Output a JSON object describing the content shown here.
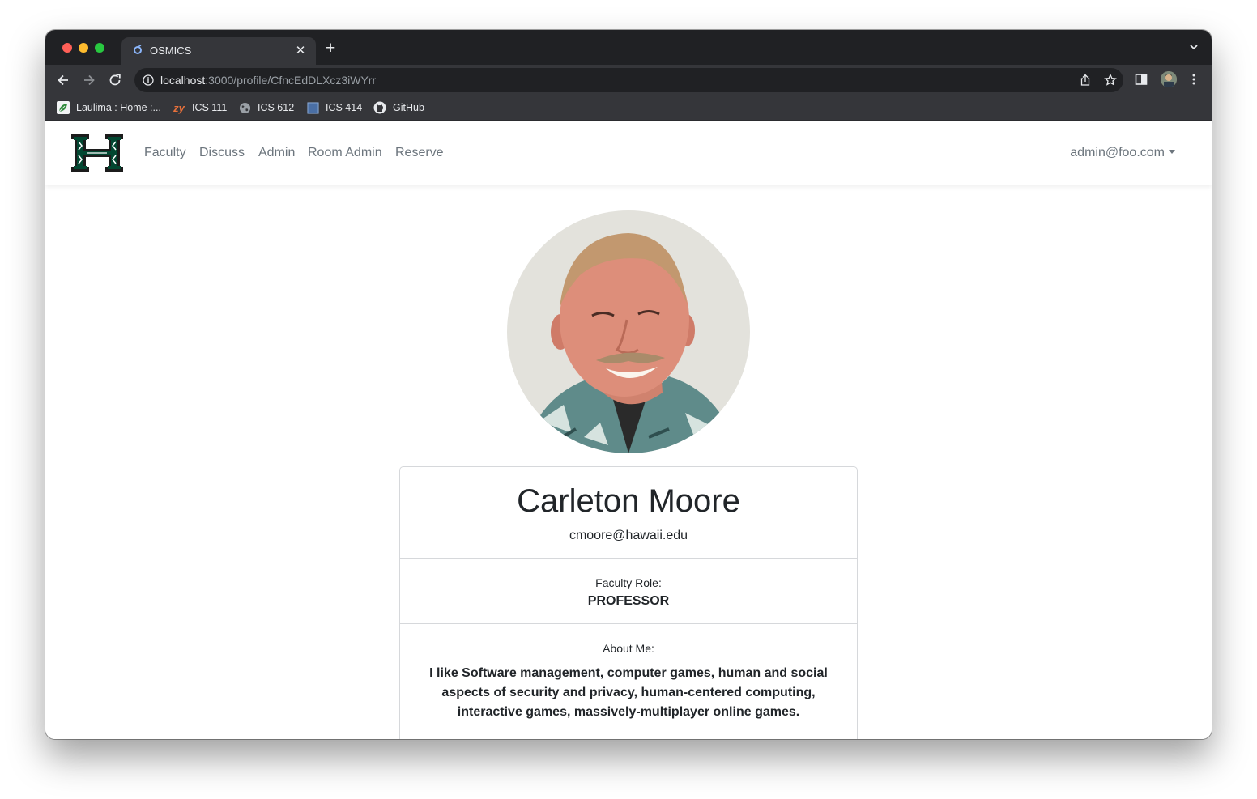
{
  "browser": {
    "tab": {
      "title": "OSMICS"
    },
    "address": {
      "host": "localhost",
      "rest": ":3000/profile/CfncEdDLXcz3iWYrr"
    },
    "bookmarks": [
      {
        "label": "Laulima : Home :...",
        "icon": "laulima-leaf-icon"
      },
      {
        "label": "ICS 111",
        "icon": "zybooks-icon"
      },
      {
        "label": "ICS 612",
        "icon": "globe-icon"
      },
      {
        "label": "ICS 414",
        "icon": "square-icon"
      },
      {
        "label": "GitHub",
        "icon": "github-icon"
      }
    ]
  },
  "navbar": {
    "logo": "hawaii-h-logo",
    "links": [
      "Faculty",
      "Discuss",
      "Admin",
      "Room Admin",
      "Reserve"
    ],
    "user": "admin@foo.com"
  },
  "profile": {
    "name": "Carleton Moore",
    "email": "cmoore@hawaii.edu",
    "role_label": "Faculty Role:",
    "role": "PROFESSOR",
    "about_label": "About Me:",
    "about": "I like Software management, computer games, human and social aspects of security and privacy, human-centered computing, interactive games, massively-multiplayer online games."
  },
  "colors": {
    "accent_green": "#024731",
    "nav_text": "#6c757d",
    "browser_dark": "#202124",
    "browser_toolbar": "#35363a"
  }
}
